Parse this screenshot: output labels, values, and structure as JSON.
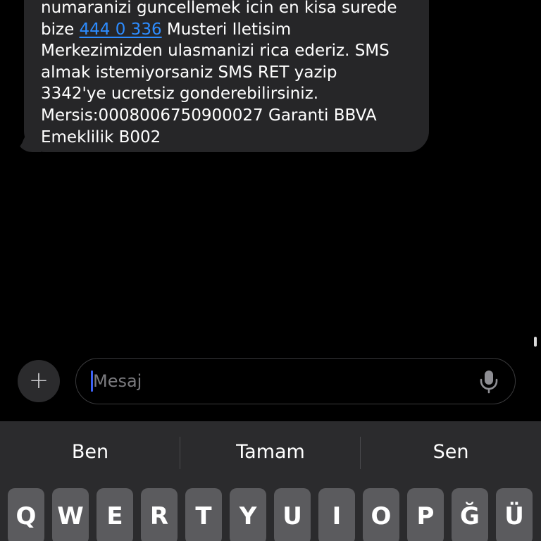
{
  "message": {
    "lines": [
      "numaranizi guncellemek icin en kisa surede",
      "Musteri Iletisim",
      "Merkezimizden ulasmanizi rica ederiz. SMS",
      "almak istemiyorsaniz SMS RET yazip",
      "3342'ye ucretsiz gonderebilirsiniz.",
      "Mersis:0008006750900027 Garanti BBVA",
      "Emeklilik B002"
    ],
    "line2_prefix": "bize ",
    "phone_link": "444 0 336"
  },
  "composer": {
    "plus_label": "+",
    "placeholder": "Mesaj",
    "mic_icon": "microphone-icon",
    "caret_color": "#3d62f5"
  },
  "keyboard": {
    "suggestions": [
      "Ben",
      "Tamam",
      "Sen"
    ],
    "top_row": [
      "Q",
      "W",
      "E",
      "R",
      "T",
      "Y",
      "U",
      "I",
      "O",
      "P",
      "Ğ",
      "Ü"
    ]
  },
  "colors": {
    "background": "#000000",
    "bubble": "#262628",
    "link": "#2d8cff",
    "keyboard": "#2b2b2d",
    "key": "#5b5b5e"
  }
}
